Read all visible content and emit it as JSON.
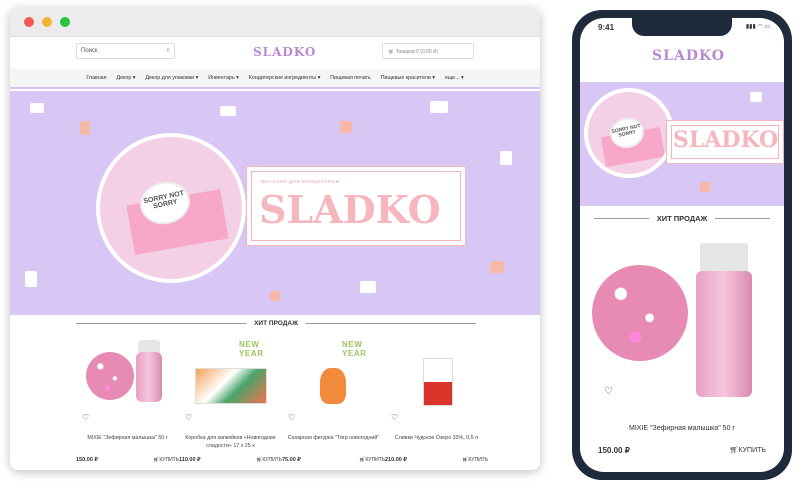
{
  "header": {
    "search_placeholder": "Поиск",
    "logo": "SLADKO",
    "cart": "Товаров 0 (0.00 ₽)"
  },
  "nav": [
    "Главная",
    "Декор ▾",
    "Декор для упаковки ▾",
    "Инвентарь ▾",
    "Кондитерские ингредиенты ▾",
    "Пищевая печать",
    "Пищевые красители ▾",
    "еще... ▾"
  ],
  "banner": {
    "brand": "SLADKO",
    "tagline": "МАГАЗИН ДЛЯ КОНДИТЕРОВ",
    "cookie_text": "SORRY NOT SORRY"
  },
  "section_title": "ХИТ ПРОДАЖ",
  "products": [
    {
      "name": "MIXIE \"Зефирная малышка\" 50 г",
      "price": "150.00 ₽",
      "buy": "КУПИТЬ",
      "badge": ""
    },
    {
      "name": "Коробка для капкейков «Новогодние сладости» 17 х 25 х",
      "price": "110.00 ₽",
      "buy": "КУПИТЬ",
      "badge": "NEW YEAR"
    },
    {
      "name": "Сахарная фигурка \"Тигр новогодний\"",
      "price": "75.00 ₽",
      "buy": "КУПИТЬ",
      "badge": "NEW YEAR"
    },
    {
      "name": "Сливки Чудское Озеро 33%, 0,5 л",
      "price": "210.00 ₽",
      "buy": "КУПИТЬ",
      "badge": ""
    }
  ],
  "phone": {
    "time": "9:41",
    "logo": "SLADKO",
    "section_title": "ХИТ ПРОДАЖ",
    "product_name": "MIXIE \"Зефирная малышка\" 50 г",
    "price": "150.00 ₽",
    "buy": "КУПИТЬ"
  }
}
